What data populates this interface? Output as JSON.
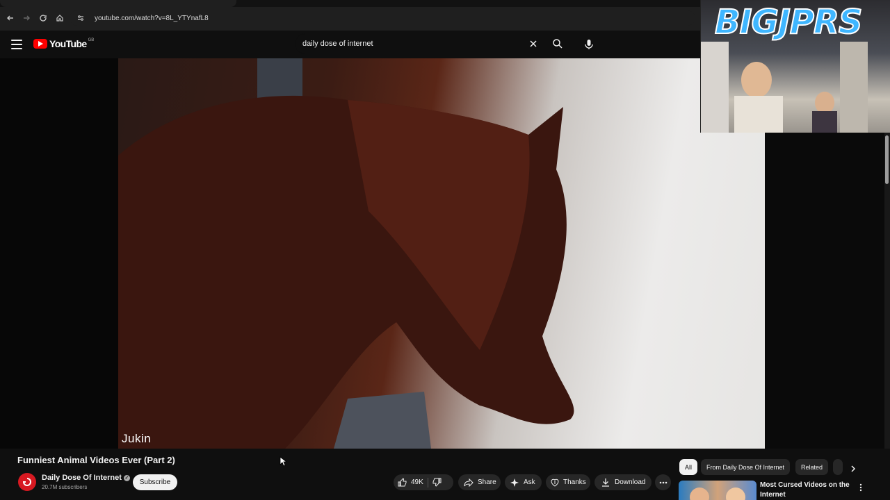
{
  "browser": {
    "url": "youtube.com/watch?v=8L_YTYnafL8"
  },
  "header": {
    "logo_text": "YouTube",
    "logo_region": "GB",
    "search_value": "daily dose of internet"
  },
  "player": {
    "watermark": "Jukin"
  },
  "webcam": {
    "overlay_title": "BIGJPRS"
  },
  "video": {
    "title": "Funniest Animal Videos Ever (Part 2)",
    "channel_name": "Daily Dose Of Internet",
    "subscribers": "20.7M subscribers",
    "subscribe_label": "Subscribe"
  },
  "actions": {
    "like_count": "49K",
    "share_label": "Share",
    "ask_label": "Ask",
    "thanks_label": "Thanks",
    "download_label": "Download"
  },
  "chips": {
    "all": "All",
    "from_channel": "From Daily Dose Of Internet",
    "related": "Related"
  },
  "recommendation": {
    "title": "Most Cursed Videos on the Internet"
  },
  "colors": {
    "background": "#0f0f0f",
    "brand_red": "#ff0000",
    "pill_bg": "#272727",
    "webcam_title": "#3fb6ff"
  }
}
